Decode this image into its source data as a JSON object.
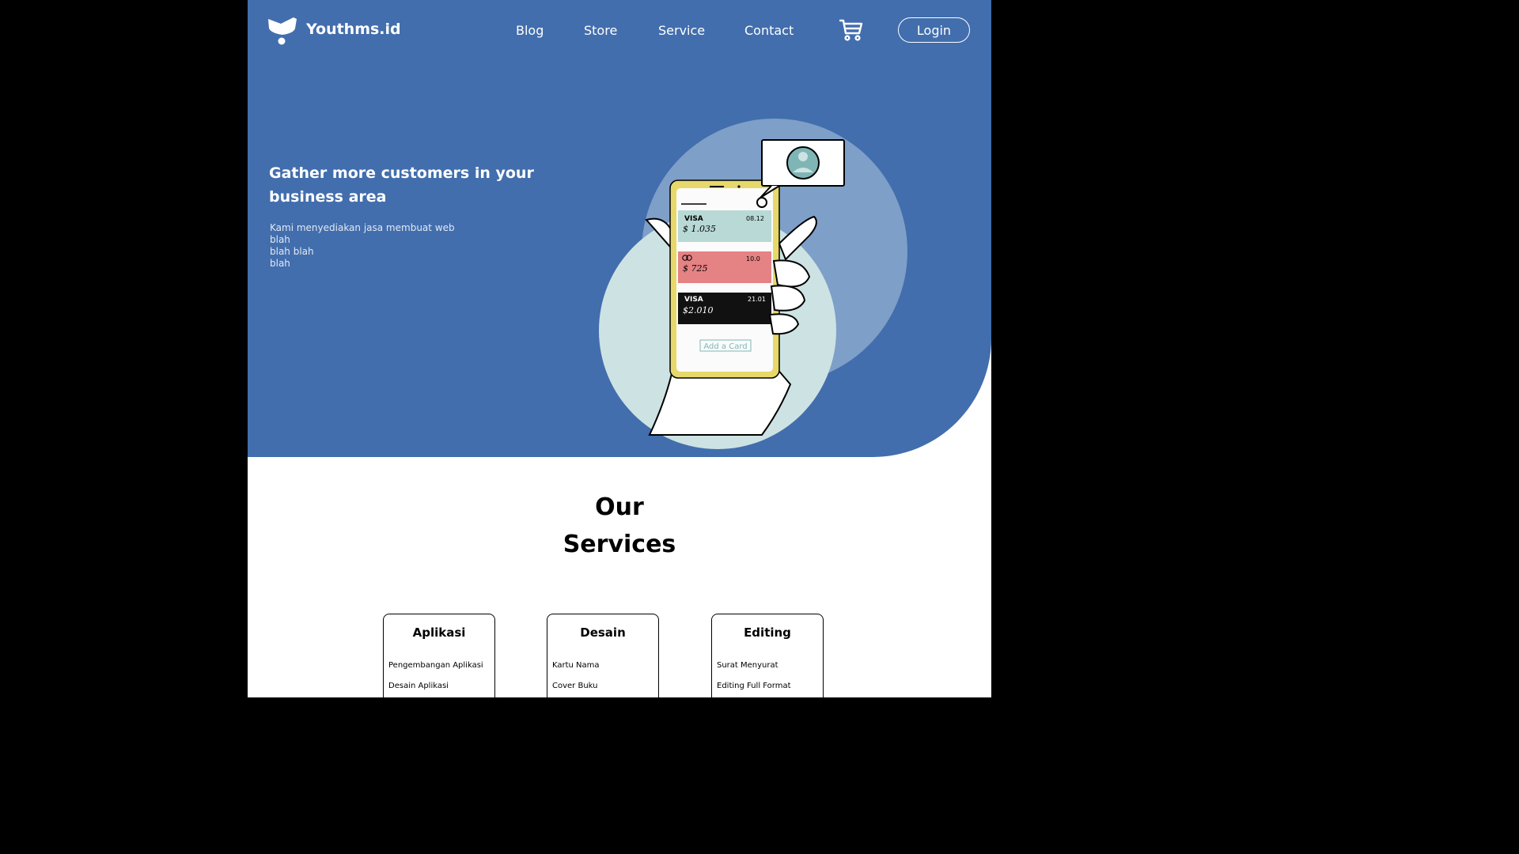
{
  "nav": {
    "brand": "Youthms.id",
    "links": [
      "Blog",
      "Store",
      "Service",
      "Contact"
    ],
    "login_label": "Login"
  },
  "hero": {
    "headline": "Gather more customers in your business area",
    "subtext_lines": [
      "Kami menyediakan jasa membuat web blah",
      "blah blah",
      "blah"
    ],
    "illustration": {
      "cards": [
        {
          "brand": "VISA",
          "date": "08.12",
          "amount": "$ 1.035"
        },
        {
          "brand": "",
          "date": "10.0",
          "amount": "$ 725"
        },
        {
          "brand": "VISA",
          "date": "21.01",
          "amount": "$2.010"
        }
      ],
      "add_card_label": "Add a Card"
    }
  },
  "services": {
    "title_line1": "Our",
    "title_line2": "Services",
    "cards": [
      {
        "title": "Aplikasi",
        "items": [
          "Pengembangan Aplikasi",
          "Desain Aplikasi"
        ]
      },
      {
        "title": "Desain",
        "items": [
          "Kartu Nama",
          "Cover Buku"
        ]
      },
      {
        "title": "Editing",
        "items": [
          "Surat Menyurat",
          "Editing Full Format"
        ]
      }
    ]
  },
  "colors": {
    "hero_bg": "#426ead",
    "light_circle": "#7e9fc8",
    "pale_circle": "#cde2e3",
    "phone_frame": "#e6d86a",
    "card_teal": "#b8d9d5",
    "card_pink": "#e58283"
  },
  "icons": [
    "logo-icon",
    "cart-icon",
    "avatar-icon"
  ]
}
